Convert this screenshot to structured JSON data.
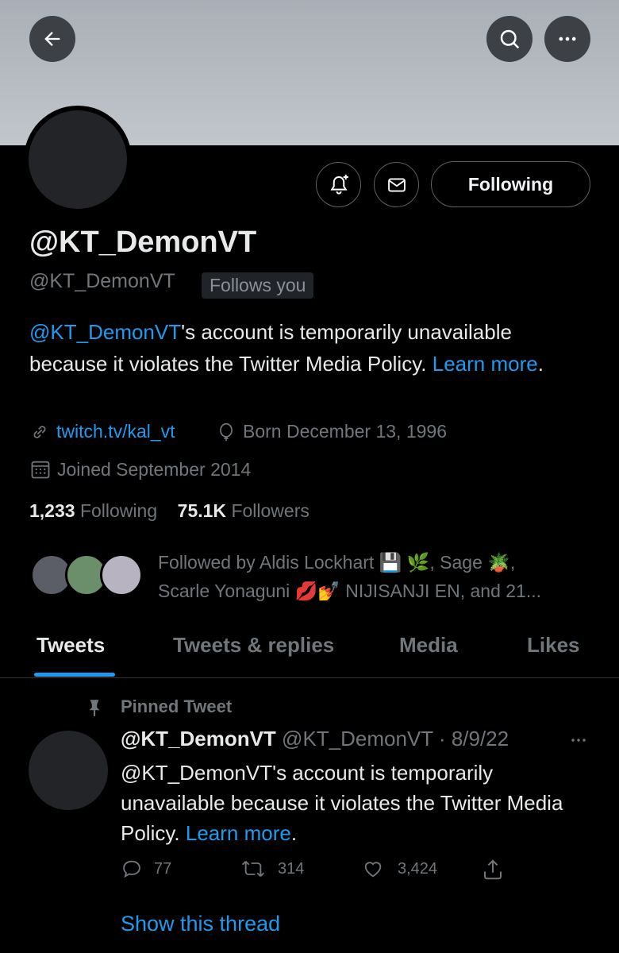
{
  "header": {
    "back_icon": "arrow-left-icon",
    "search_icon": "search-icon",
    "more_icon": "more-horizontal-icon"
  },
  "profile": {
    "display_name": "@KT_DemonVT",
    "handle": "@KT_DemonVT",
    "follows_you": "Follows you",
    "following_button": "Following",
    "bio": {
      "mention": "@KT_DemonVT",
      "text": "'s account is temporarily unavailable because it violates the Twitter Media Policy. ",
      "learn_more": "Learn more",
      "period": "."
    },
    "website": "twitch.tv/kal_vt",
    "birthday": "Born December 13, 1996",
    "joined": "Joined September 2014",
    "following_count": "1,233",
    "following_label": "Following",
    "followers_count": "75.1K",
    "followers_label": "Followers",
    "followed_by_line1": "Followed by Aldis Lockhart 💾 🌿, Sage 🪴,",
    "followed_by_line2": "Scarle Yonaguni 💋💅 NIJISANJI EN, and 21..."
  },
  "tabs": [
    {
      "label": "Tweets",
      "active": true
    },
    {
      "label": "Tweets & replies",
      "active": false
    },
    {
      "label": "Media",
      "active": false
    },
    {
      "label": "Likes",
      "active": false
    }
  ],
  "tweet": {
    "pinned_label": "Pinned Tweet",
    "name": "@KT_DemonVT",
    "handle": "@KT_DemonVT",
    "separator": " · ",
    "date": "8/9/22",
    "text_main": "@KT_DemonVT's account is temporarily unavailable because it violates the Twitter Media Policy. ",
    "learn_more": "Learn more",
    "period": ".",
    "replies": "77",
    "retweets": "314",
    "likes": "3,424",
    "show_thread": "Show this thread"
  },
  "colors": {
    "accent": "#1d9bf0",
    "background": "#000000",
    "secondary_text": "#71767b"
  }
}
